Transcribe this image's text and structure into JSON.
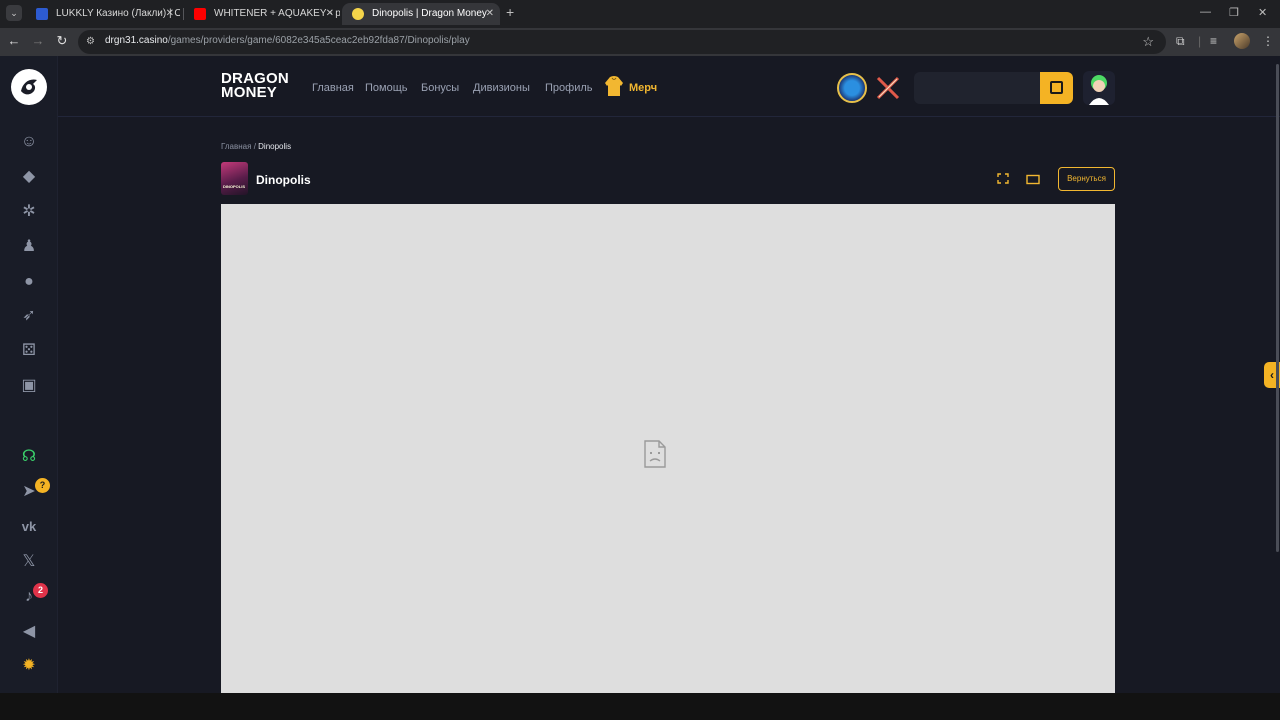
{
  "browser": {
    "tabs": [
      {
        "title": "LUKKLY Казино (Лакли) | Офиц",
        "close": "✕"
      },
      {
        "title": "WHITENER + AQUAKEY - p",
        "close": "✕"
      },
      {
        "title": "Dinopolis | Dragon Money",
        "close": "✕"
      }
    ],
    "new_tab": "+",
    "url_host": "drgn31.casino",
    "url_path": "/games/providers/game/6082e345a5ceac2eb92fda87/Dinopolis/play"
  },
  "site": {
    "brand_line1": "DRAGON",
    "brand_line2": "MONEY",
    "nav": [
      "Главная",
      "Помощь",
      "Бонусы",
      "Дивизионы",
      "Профиль"
    ],
    "merch": "Мерч",
    "breadcrumb": {
      "home": "Главная",
      "separator": "/",
      "current": "Dinopolis"
    },
    "game": {
      "title": "Dinopolis",
      "thumb_label": "DINOPOLIS"
    },
    "return_button": "Вернуться",
    "badges": {
      "telegram": "?",
      "notifications": "2"
    },
    "colors": {
      "accent": "#f2b731",
      "frame_bg": "#dedede",
      "bg": "#171923"
    }
  }
}
